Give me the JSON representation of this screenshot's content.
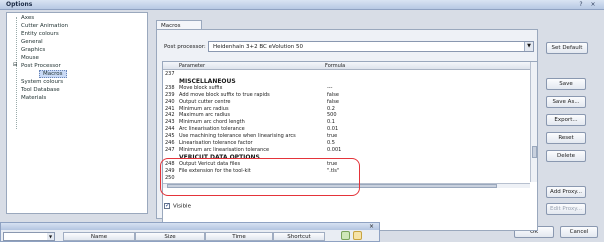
{
  "window": {
    "title": "Options",
    "help": "?",
    "close": "×"
  },
  "tree": {
    "items": [
      {
        "label": "Axes"
      },
      {
        "label": "Cutter Animation"
      },
      {
        "label": "Entity colours"
      },
      {
        "label": "General"
      },
      {
        "label": "Graphics"
      },
      {
        "label": "Mouse"
      },
      {
        "label": "Post Processor",
        "expander": "⊟"
      },
      {
        "label": "Macros"
      },
      {
        "label": "System colours"
      },
      {
        "label": "Tool Database"
      },
      {
        "label": "Materials"
      }
    ]
  },
  "tab": {
    "label": "Macros"
  },
  "post_processor": {
    "label": "Post processor:",
    "value": "Heidenhain 3+2 BC eVolution 50"
  },
  "buttons": {
    "set_default": "Set Default",
    "save": "Save",
    "save_as": "Save As...",
    "export": "Export...",
    "reset": "Reset",
    "delete": "Delete",
    "add_proxy": "Add Proxy...",
    "edit_proxy": "Edit Proxy...",
    "ok": "OK",
    "cancel": "Cancel"
  },
  "table": {
    "columns": [
      "Parameter",
      "Formula"
    ],
    "rows": [
      {
        "num": "237",
        "param": "",
        "value": ""
      },
      {
        "num": "",
        "param": "MISCELLANEOUS",
        "value": "",
        "section": true
      },
      {
        "num": "238",
        "param": "Move block suffix",
        "value": "---"
      },
      {
        "num": "239",
        "param": "Add move block suffix to true rapids",
        "value": "false"
      },
      {
        "num": "240",
        "param": "Output cutter centre",
        "value": "false"
      },
      {
        "num": "241",
        "param": "Minimum arc radius",
        "value": "0.2"
      },
      {
        "num": "242",
        "param": "Maximum arc radius",
        "value": "500"
      },
      {
        "num": "243",
        "param": "Minimum arc chord length",
        "value": "0.1"
      },
      {
        "num": "244",
        "param": "Arc linearisation tolerance",
        "value": "0.01"
      },
      {
        "num": "245",
        "param": "Use machining tolerance when linearising arcs",
        "value": "true"
      },
      {
        "num": "246",
        "param": "Linearisation tolerance factor",
        "value": "0.5"
      },
      {
        "num": "247",
        "param": "Minimum arc linearisation tolerance",
        "value": "0.001"
      },
      {
        "num": "",
        "param": "VERICUT DATA OPTIONS",
        "value": "",
        "section": true
      },
      {
        "num": "248",
        "param": "Output Vericut data files",
        "value": "true"
      },
      {
        "num": "249",
        "param": "File extension for the tool-kit",
        "value": "\".tls\""
      },
      {
        "num": "250",
        "param": "",
        "value": ""
      }
    ]
  },
  "visible": {
    "label": "Visible",
    "checked": true
  },
  "subwindow": {
    "close": "×",
    "columns": [
      "Name",
      "Size",
      "Time",
      "Shortcut"
    ]
  }
}
